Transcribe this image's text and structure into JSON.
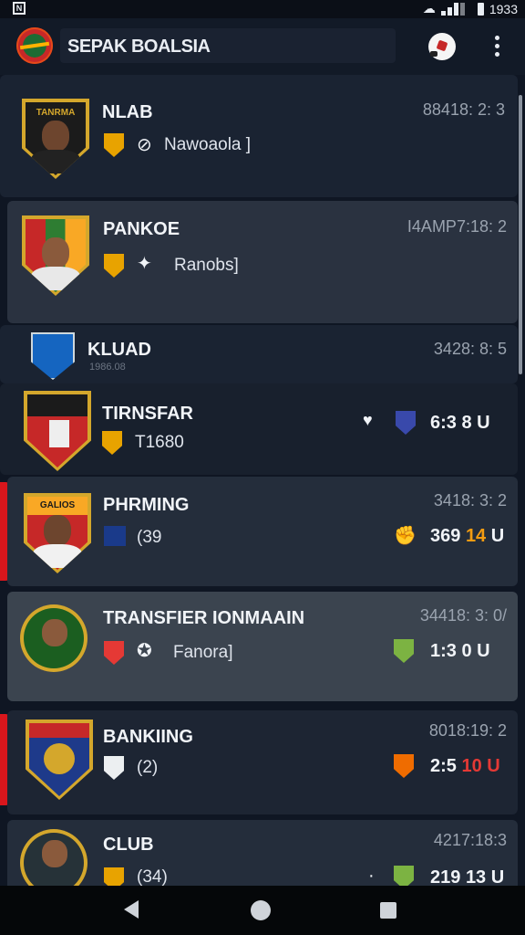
{
  "status_bar": {
    "time": "1933",
    "notification_icon": "notification-icon",
    "wifi_icon": "wifi-icon",
    "signal_icon": "signal-icon",
    "battery_icon": "battery-icon"
  },
  "app_bar": {
    "title": "SEPAK BOALSIA",
    "logo_icon": "app-logo-icon",
    "ball_icon": "soccer-ball-icon",
    "menu_icon": "more-vert-icon"
  },
  "rows": [
    {
      "name": "NLAB",
      "sub": "Nawoaola ]",
      "time": "88418: 2: 3",
      "crest_text": "TANRMA"
    },
    {
      "name": "PANKOE",
      "sub": "Ranobs]",
      "time": "I4AMP7:18: 2"
    },
    {
      "name": "KLUAD",
      "sub": "1986.08",
      "time": "3428: 8: 5"
    },
    {
      "name": "TIRNSFAR",
      "sub": "T1680",
      "score": "6:3",
      "score_a": "8",
      "score_b": "U"
    },
    {
      "name": "PHRMING",
      "sub": "(39",
      "time": "3418: 3: 2",
      "score": "369",
      "score_a": "14",
      "score_b": "U",
      "crest_text": "GALIOS"
    },
    {
      "name": "TRANSFIER IONMAAIN",
      "sub": "Fanora]",
      "time": "34418: 3: 0/",
      "score": "1:3",
      "score_a": "0",
      "score_b": "U"
    },
    {
      "name": "BANKIING",
      "sub": "(2)",
      "time": "8018:19: 2",
      "score": "2:5",
      "score_a": "10",
      "score_b": "U"
    },
    {
      "name": "CLUB",
      "sub": "(34)",
      "time": "4217:18:3",
      "score": "219",
      "score_a": "13",
      "score_b": "U"
    }
  ],
  "colors": {
    "background": "#0f1623",
    "accent_red": "#d9161c",
    "gold": "#d4a72c"
  }
}
